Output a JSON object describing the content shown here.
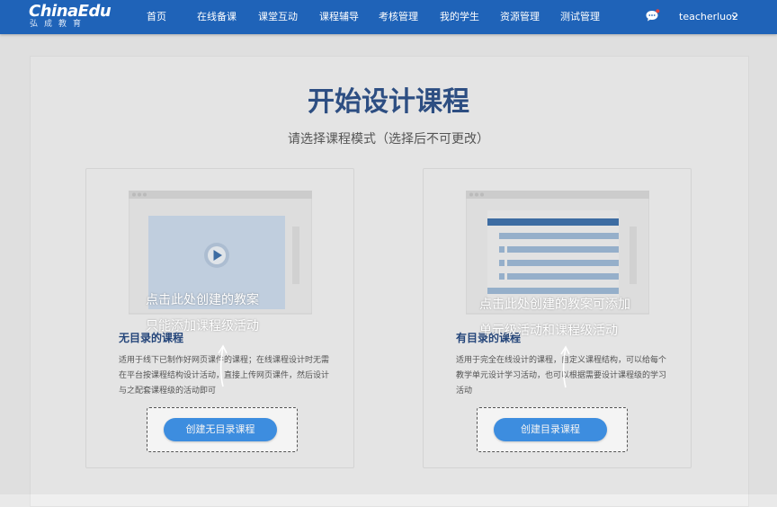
{
  "header": {
    "logo_en": "ChinaEdu",
    "logo_cn": "弘成教育",
    "nav": [
      {
        "label": "首页"
      },
      {
        "label": "在线备课"
      },
      {
        "label": "课堂互动"
      },
      {
        "label": "课程辅导"
      },
      {
        "label": "考核管理"
      },
      {
        "label": "我的学生"
      },
      {
        "label": "资源管理"
      },
      {
        "label": "测试管理"
      }
    ],
    "username": "teacherluo2",
    "icons": {
      "message": "chat-bubble-icon",
      "user_menu": "chevron-down-icon"
    }
  },
  "main": {
    "title": "开始设计课程",
    "subtitle": "请选择课程模式（选择后不可更改）"
  },
  "cards": [
    {
      "illustration": "video-player-icon",
      "title": "无目录的课程",
      "desc": "适用于线下已制作好网页课件的课程；在线课程设计时无需在平台按课程结构设计活动，直接上传网页课件，然后设计与之配套课程级的活动即可",
      "button": "创建无目录课程",
      "hint": [
        "点击此处创建的教案",
        "只能添加课程级活动"
      ]
    },
    {
      "illustration": "outline-list-icon",
      "title": "有目录的课程",
      "desc": "适用于完全在线设计的课程，自定义课程结构，可以给每个教学单元设计学习活动，也可以根据需要设计课程级的学习活动",
      "button": "创建目录课程",
      "hint": [
        "点击此处创建的教案可添加",
        "单元级活动和课程级活动"
      ]
    }
  ],
  "colors": {
    "nav_bg": "#1f63b8",
    "title": "#2c4f86",
    "button": "#3d92e9",
    "page_bg": "#e9e9e9"
  }
}
